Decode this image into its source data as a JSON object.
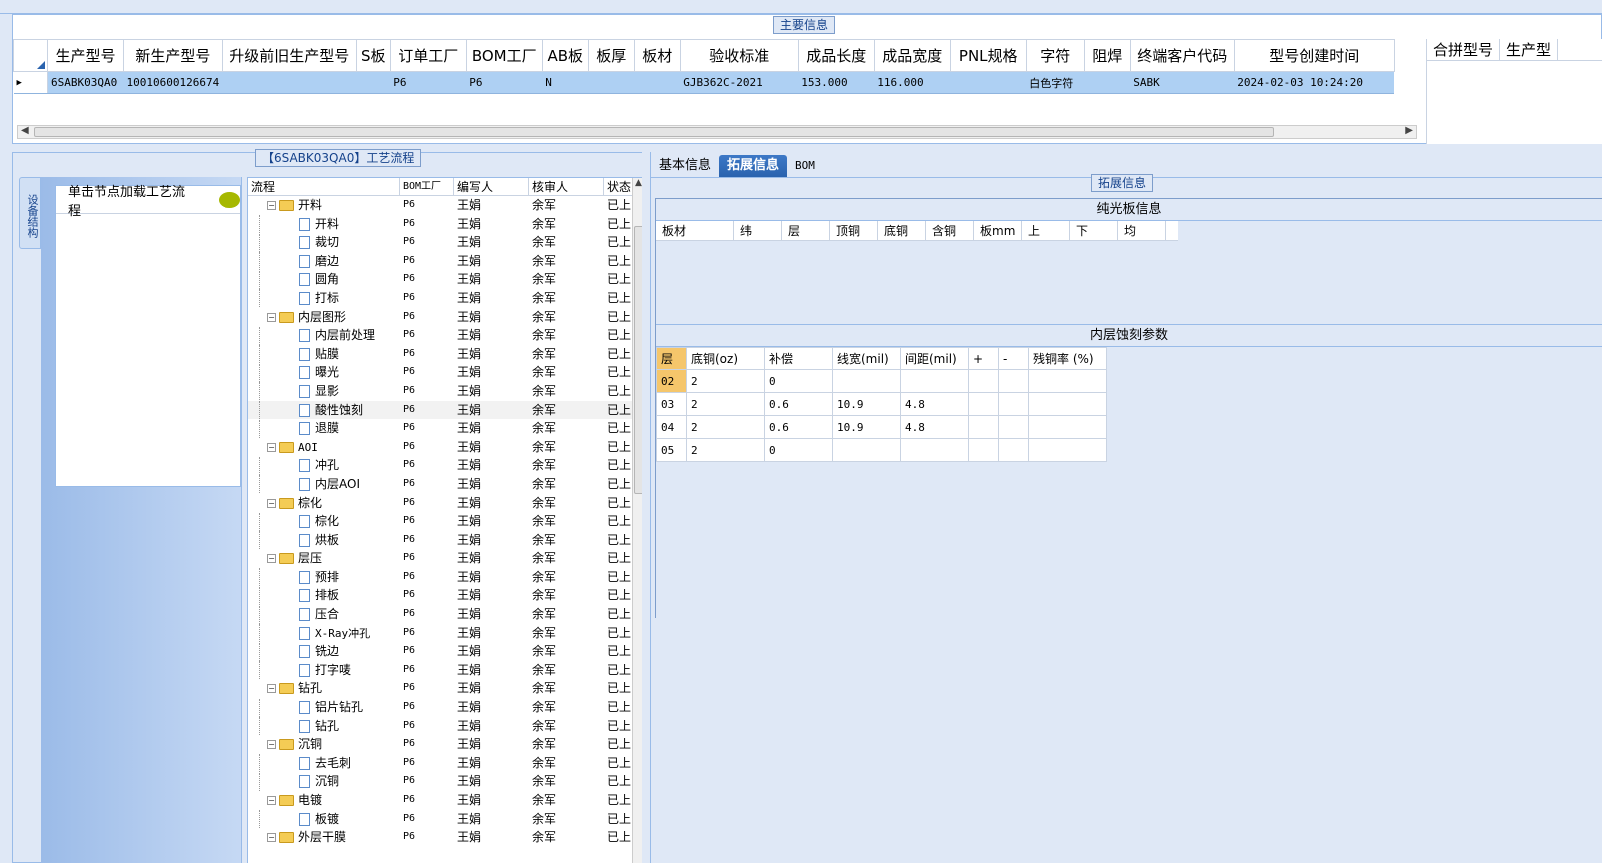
{
  "main_info": {
    "title": "主要信息",
    "columns": [
      "生产型号",
      "新生产型号",
      "升级前旧生产型号",
      "S板",
      "订单工厂",
      "BOM工厂",
      "AB板",
      "板厚",
      "板材",
      "验收标准",
      "成品长度",
      "成品宽度",
      "PNL规格",
      "字符",
      "阻焊",
      "终端客户代码",
      "型号创建时间"
    ],
    "row": [
      "6SABK03QA0",
      "10010600126674",
      "",
      "",
      "P6",
      "P6",
      "N",
      "",
      "",
      "GJB362C-2021",
      "153.000",
      "116.000",
      "",
      "白色字符",
      "",
      "SABK",
      "2024-02-03 10:24:20"
    ],
    "merge_columns": [
      "合拼型号",
      "生产型"
    ]
  },
  "left_panel": {
    "title": "【6SABK03QA0】工艺流程",
    "vertical_tab": "设备结构",
    "node_hint": "单击节点加载工艺流程",
    "tree_columns": [
      "流程",
      "BOM工厂",
      "编写人",
      "核审人",
      "状态"
    ],
    "tree_rows": [
      {
        "name": "开料",
        "type": "folder",
        "bom": "P6",
        "writer": "王娟",
        "checker": "余军",
        "state": "已上网"
      },
      {
        "name": "开料",
        "type": "doc",
        "bom": "P6",
        "writer": "王娟",
        "checker": "余军",
        "state": "已上网"
      },
      {
        "name": "裁切",
        "type": "doc",
        "bom": "P6",
        "writer": "王娟",
        "checker": "余军",
        "state": "已上网"
      },
      {
        "name": "磨边",
        "type": "doc",
        "bom": "P6",
        "writer": "王娟",
        "checker": "余军",
        "state": "已上网"
      },
      {
        "name": "圆角",
        "type": "doc",
        "bom": "P6",
        "writer": "王娟",
        "checker": "余军",
        "state": "已上网"
      },
      {
        "name": "打标",
        "type": "doc",
        "bom": "P6",
        "writer": "王娟",
        "checker": "余军",
        "state": "已上网"
      },
      {
        "name": "内层图形",
        "type": "folder",
        "bom": "P6",
        "writer": "王娟",
        "checker": "余军",
        "state": "已上网"
      },
      {
        "name": "内层前处理",
        "type": "doc",
        "bom": "P6",
        "writer": "王娟",
        "checker": "余军",
        "state": "已上网"
      },
      {
        "name": "贴膜",
        "type": "doc",
        "bom": "P6",
        "writer": "王娟",
        "checker": "余军",
        "state": "已上网"
      },
      {
        "name": "曝光",
        "type": "doc",
        "bom": "P6",
        "writer": "王娟",
        "checker": "余军",
        "state": "已上网"
      },
      {
        "name": "显影",
        "type": "doc",
        "bom": "P6",
        "writer": "王娟",
        "checker": "余军",
        "state": "已上网"
      },
      {
        "name": "酸性蚀刻",
        "type": "doc",
        "bom": "P6",
        "writer": "王娟",
        "checker": "余军",
        "state": "已上网",
        "selected": true
      },
      {
        "name": "退膜",
        "type": "doc",
        "bom": "P6",
        "writer": "王娟",
        "checker": "余军",
        "state": "已上网"
      },
      {
        "name": "AOI",
        "type": "folder",
        "bom": "P6",
        "writer": "王娟",
        "checker": "余军",
        "state": "已上网"
      },
      {
        "name": "冲孔",
        "type": "doc",
        "bom": "P6",
        "writer": "王娟",
        "checker": "余军",
        "state": "已上网"
      },
      {
        "name": "内层AOI",
        "type": "doc",
        "bom": "P6",
        "writer": "王娟",
        "checker": "余军",
        "state": "已上网"
      },
      {
        "name": "棕化",
        "type": "folder",
        "bom": "P6",
        "writer": "王娟",
        "checker": "余军",
        "state": "已上网"
      },
      {
        "name": "棕化",
        "type": "doc",
        "bom": "P6",
        "writer": "王娟",
        "checker": "余军",
        "state": "已上网"
      },
      {
        "name": "烘板",
        "type": "doc",
        "bom": "P6",
        "writer": "王娟",
        "checker": "余军",
        "state": "已上网"
      },
      {
        "name": "层压",
        "type": "folder",
        "bom": "P6",
        "writer": "王娟",
        "checker": "余军",
        "state": "已上网"
      },
      {
        "name": "预排",
        "type": "doc",
        "bom": "P6",
        "writer": "王娟",
        "checker": "余军",
        "state": "已上网"
      },
      {
        "name": "排板",
        "type": "doc",
        "bom": "P6",
        "writer": "王娟",
        "checker": "余军",
        "state": "已上网"
      },
      {
        "name": "压合",
        "type": "doc",
        "bom": "P6",
        "writer": "王娟",
        "checker": "余军",
        "state": "已上网"
      },
      {
        "name": "X-Ray冲孔",
        "type": "doc",
        "bom": "P6",
        "writer": "王娟",
        "checker": "余军",
        "state": "已上网"
      },
      {
        "name": "铣边",
        "type": "doc",
        "bom": "P6",
        "writer": "王娟",
        "checker": "余军",
        "state": "已上网"
      },
      {
        "name": "打字唛",
        "type": "doc",
        "bom": "P6",
        "writer": "王娟",
        "checker": "余军",
        "state": "已上网"
      },
      {
        "name": "钻孔",
        "type": "folder",
        "bom": "P6",
        "writer": "王娟",
        "checker": "余军",
        "state": "已上网"
      },
      {
        "name": "铝片钻孔",
        "type": "doc",
        "bom": "P6",
        "writer": "王娟",
        "checker": "余军",
        "state": "已上网"
      },
      {
        "name": "钻孔",
        "type": "doc",
        "bom": "P6",
        "writer": "王娟",
        "checker": "余军",
        "state": "已上网"
      },
      {
        "name": "沉铜",
        "type": "folder",
        "bom": "P6",
        "writer": "王娟",
        "checker": "余军",
        "state": "已上网"
      },
      {
        "name": "去毛刺",
        "type": "doc",
        "bom": "P6",
        "writer": "王娟",
        "checker": "余军",
        "state": "已上网"
      },
      {
        "name": "沉铜",
        "type": "doc",
        "bom": "P6",
        "writer": "王娟",
        "checker": "余军",
        "state": "已上网"
      },
      {
        "name": "电镀",
        "type": "folder",
        "bom": "P6",
        "writer": "王娟",
        "checker": "余军",
        "state": "已上网"
      },
      {
        "name": "板镀",
        "type": "doc",
        "bom": "P6",
        "writer": "王娟",
        "checker": "余军",
        "state": "已上网"
      },
      {
        "name": "外层干膜",
        "type": "folder",
        "bom": "P6",
        "writer": "王娟",
        "checker": "余军",
        "state": "已上网"
      }
    ]
  },
  "right_panel": {
    "tabs": [
      "基本信息",
      "拓展信息",
      "BOM"
    ],
    "active_tab": 1,
    "section_title": "拓展信息",
    "bare_board_title": "纯光板信息",
    "bare_board_columns": [
      "板材",
      "纬",
      "层",
      "顶铜",
      "底铜",
      "含铜",
      "板mm",
      "上",
      "下",
      "均"
    ],
    "etch_title": "内层蚀刻参数",
    "etch_columns": [
      "层",
      "底铜(oz)",
      "补偿",
      "线宽(mil)",
      "间距(mil)",
      "+",
      "-",
      "残铜率 (%)"
    ],
    "etch_rows": [
      [
        "02",
        "2",
        "0",
        "",
        "",
        "",
        "",
        ""
      ],
      [
        "03",
        "2",
        "0.6",
        "10.9",
        "4.8",
        "",
        "",
        ""
      ],
      [
        "04",
        "2",
        "0.6",
        "10.9",
        "4.8",
        "",
        "",
        ""
      ],
      [
        "05",
        "2",
        "0",
        "",
        "",
        "",
        "",
        ""
      ]
    ]
  }
}
